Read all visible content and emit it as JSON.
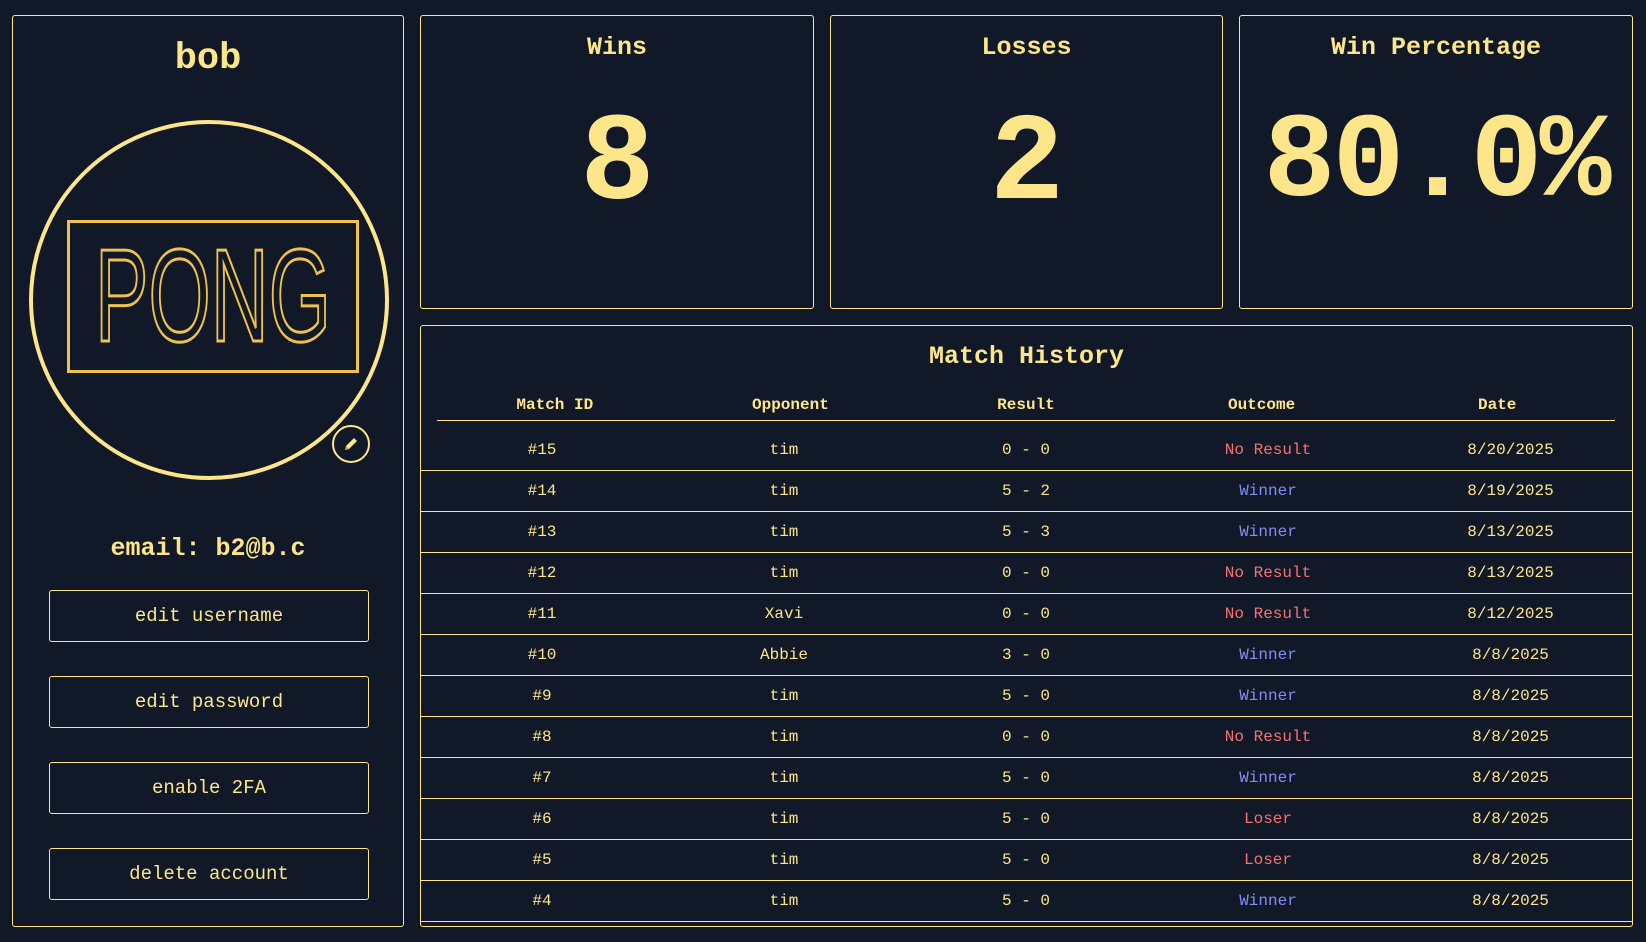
{
  "profile": {
    "username": "bob",
    "logo_text": "PONG",
    "email_label": "email: b2@b.c",
    "buttons": {
      "edit_username": "edit username",
      "edit_password": "edit password",
      "enable_2fa": "enable 2FA",
      "delete_account": "delete account"
    },
    "edit_avatar_icon": "pencil-icon"
  },
  "stats": {
    "wins": {
      "label": "Wins",
      "value": "8"
    },
    "losses": {
      "label": "Losses",
      "value": "2"
    },
    "win_percentage": {
      "label": "Win Percentage",
      "value": "80.0%"
    }
  },
  "history": {
    "title": "Match History",
    "columns": [
      "Match ID",
      "Opponent",
      "Result",
      "Outcome",
      "Date"
    ],
    "rows": [
      {
        "id": "#15",
        "opponent": "tim",
        "result": "0 - 0",
        "outcome": "No Result",
        "date": "8/20/2025"
      },
      {
        "id": "#14",
        "opponent": "tim",
        "result": "5 - 2",
        "outcome": "Winner",
        "date": "8/19/2025"
      },
      {
        "id": "#13",
        "opponent": "tim",
        "result": "5 - 3",
        "outcome": "Winner",
        "date": "8/13/2025"
      },
      {
        "id": "#12",
        "opponent": "tim",
        "result": "0 - 0",
        "outcome": "No Result",
        "date": "8/13/2025"
      },
      {
        "id": "#11",
        "opponent": "Xavi",
        "result": "0 - 0",
        "outcome": "No Result",
        "date": "8/12/2025"
      },
      {
        "id": "#10",
        "opponent": "Abbie",
        "result": "3 - 0",
        "outcome": "Winner",
        "date": "8/8/2025"
      },
      {
        "id": "#9",
        "opponent": "tim",
        "result": "5 - 0",
        "outcome": "Winner",
        "date": "8/8/2025"
      },
      {
        "id": "#8",
        "opponent": "tim",
        "result": "0 - 0",
        "outcome": "No Result",
        "date": "8/8/2025"
      },
      {
        "id": "#7",
        "opponent": "tim",
        "result": "5 - 0",
        "outcome": "Winner",
        "date": "8/8/2025"
      },
      {
        "id": "#6",
        "opponent": "tim",
        "result": "5 - 0",
        "outcome": "Loser",
        "date": "8/8/2025"
      },
      {
        "id": "#5",
        "opponent": "tim",
        "result": "5 - 0",
        "outcome": "Loser",
        "date": "8/8/2025"
      },
      {
        "id": "#4",
        "opponent": "tim",
        "result": "5 - 0",
        "outcome": "Winner",
        "date": "8/8/2025"
      }
    ]
  },
  "colors": {
    "background": "#111827",
    "accent": "#fde68a",
    "winner": "#818cf8",
    "loser": "#f87171"
  }
}
